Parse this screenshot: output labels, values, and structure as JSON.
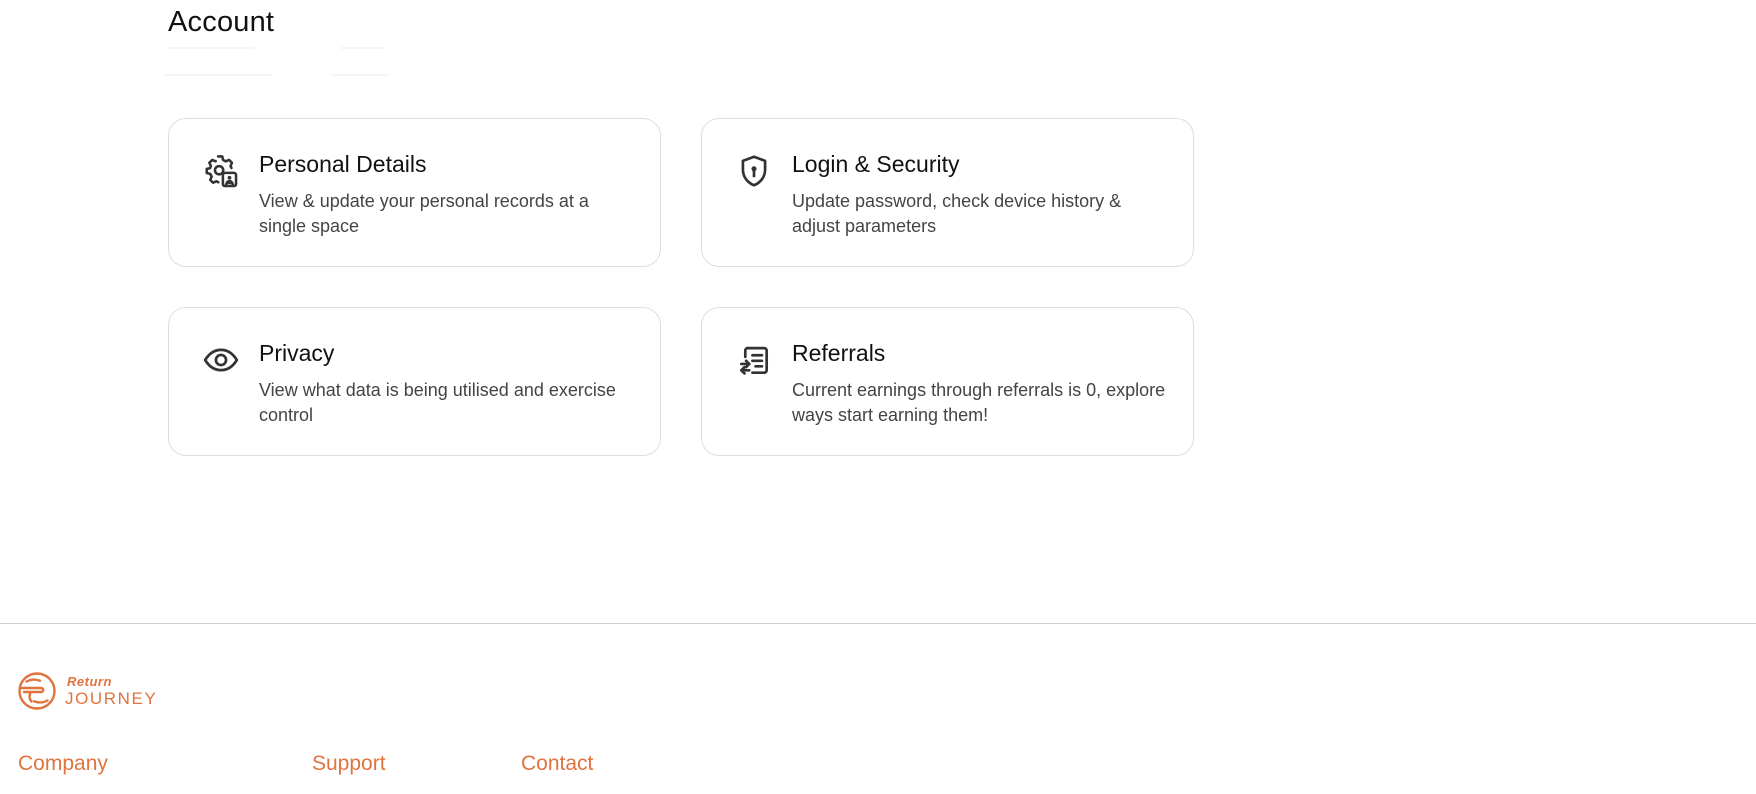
{
  "page": {
    "title": "Account"
  },
  "cards": [
    {
      "title": "Personal Details",
      "description": "View & update your personal records at a single space",
      "icon": "gear-user-icon"
    },
    {
      "title": "Login & Security",
      "description": "Update password, check device history & adjust parameters",
      "icon": "shield-lock-icon"
    },
    {
      "title": "Privacy",
      "description": "View what data is being utilised and exercise control",
      "icon": "eye-icon"
    },
    {
      "title": "Referrals",
      "description": "Current earnings through referrals is 0, explore ways start earning them!",
      "icon": "referral-list-icon"
    }
  ],
  "footer": {
    "logo": {
      "line1": "Return",
      "line2": "JOURNEY"
    },
    "sections": [
      "Company",
      "Support",
      "Contact"
    ]
  },
  "colors": {
    "accent": "#e0733e",
    "border": "#dedede",
    "text": "#111111",
    "muted": "#444444"
  }
}
